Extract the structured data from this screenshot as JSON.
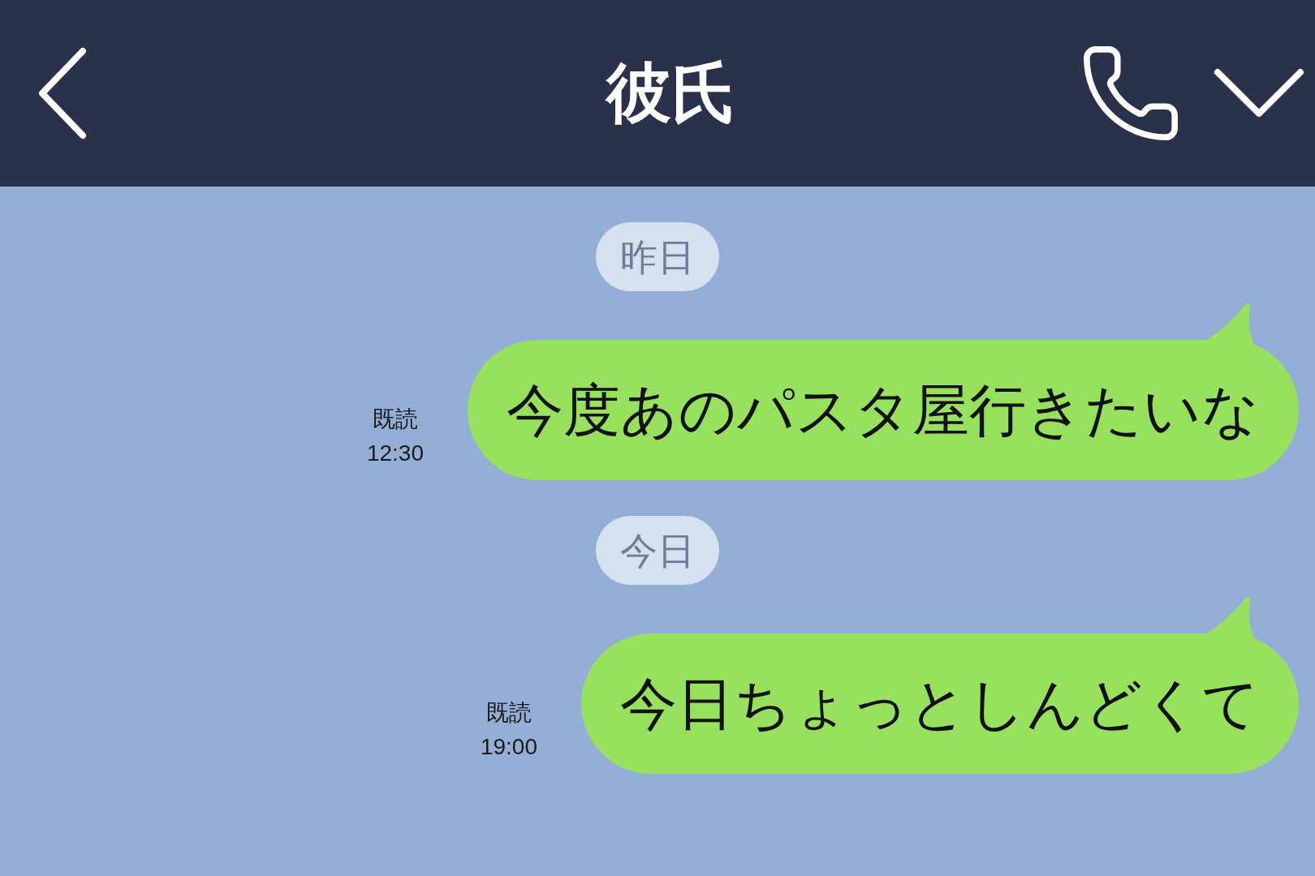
{
  "header": {
    "title": "彼氏"
  },
  "messages": [
    {
      "kind": "date",
      "label": "昨日"
    },
    {
      "kind": "sent",
      "text": "今度あのパスタ屋行きたいな",
      "read_label": "既読",
      "time": "12:30"
    },
    {
      "kind": "date",
      "label": "今日"
    },
    {
      "kind": "sent",
      "text": "今日ちょっとしんどくて",
      "read_label": "既読",
      "time": "19:00"
    }
  ]
}
